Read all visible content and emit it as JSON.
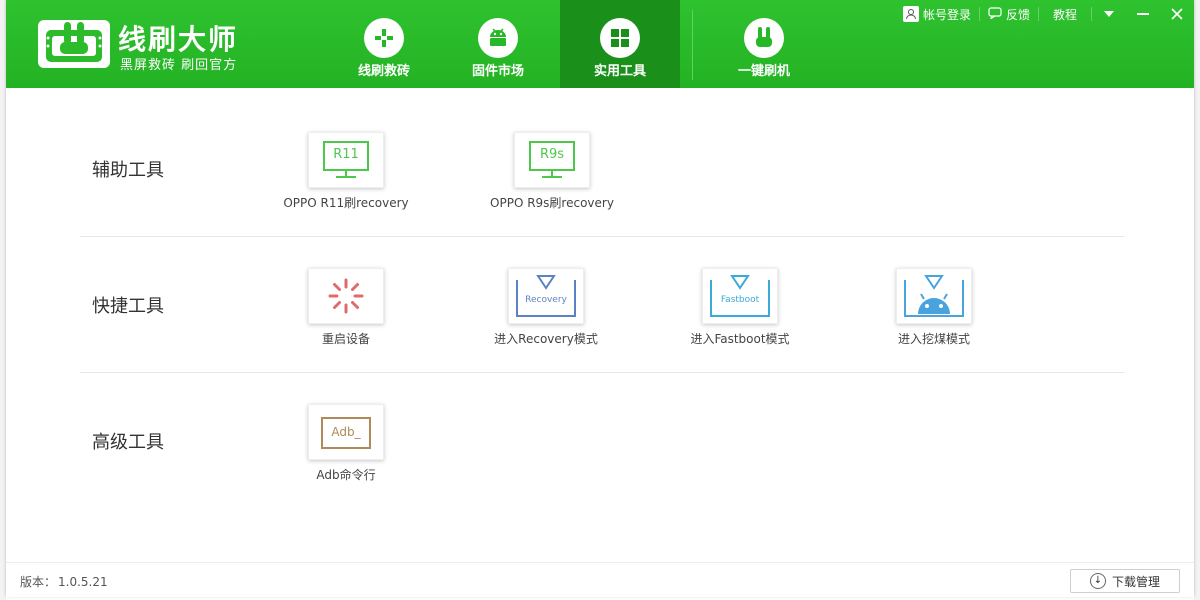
{
  "app": {
    "name": "线刷大师",
    "slogan": "黑屏救砖 刷回官方"
  },
  "nav": {
    "tabs": [
      {
        "label": "线刷救砖",
        "icon": "plus-cross-icon"
      },
      {
        "label": "固件市场",
        "icon": "android-robot-icon"
      },
      {
        "label": "实用工具",
        "icon": "grid-icon",
        "active": true
      },
      {
        "label": "一键刷机",
        "icon": "rabbit-icon"
      }
    ]
  },
  "topbar": {
    "login": "帐号登录",
    "feedback": "反馈",
    "tutorial": "教程"
  },
  "sections": [
    {
      "title": "辅助工具",
      "tools": [
        {
          "tile_text": "R11",
          "label": "OPPO R11刷recovery",
          "color": "#4cc84c"
        },
        {
          "tile_text": "R9s",
          "label": "OPPO R9s刷recovery",
          "color": "#4cc84c"
        }
      ]
    },
    {
      "title": "快捷工具",
      "tools": [
        {
          "label": "重启设备",
          "color": "#e06b6b"
        },
        {
          "tile_text": "Recovery",
          "label": "进入Recovery模式",
          "color": "#5b83c4"
        },
        {
          "tile_text": "Fastboot",
          "label": "进入Fastboot模式",
          "color": "#3aabd6"
        },
        {
          "label": "进入挖煤模式",
          "color": "#4aa3df"
        }
      ]
    },
    {
      "title": "高级工具",
      "tools": [
        {
          "tile_text": "Adb_",
          "label": "Adb命令行",
          "color": "#b08a5a"
        }
      ]
    }
  ],
  "footer": {
    "version_label": "版本：",
    "version": "1.0.5.21",
    "download_button": "下载管理"
  },
  "colors": {
    "header_green": "#27b827",
    "active_tab": "#1a8f1a"
  }
}
